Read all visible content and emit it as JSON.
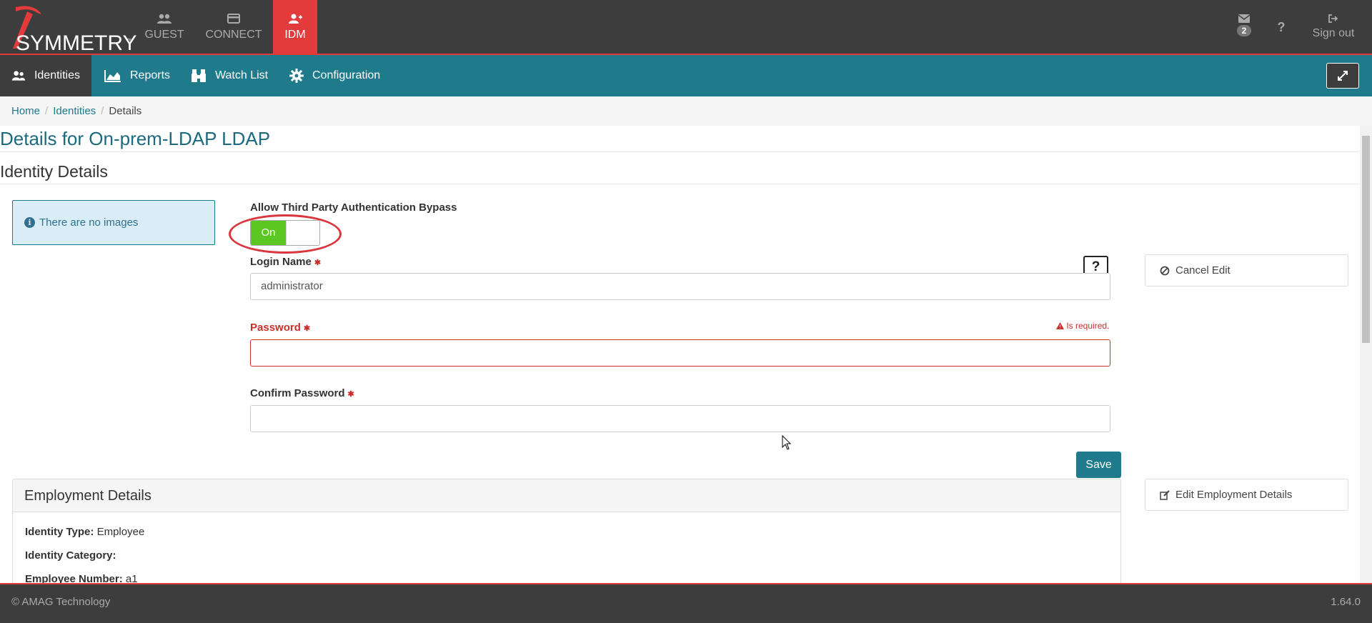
{
  "brand": {
    "name": "SYMMETRY",
    "tm": "™"
  },
  "topnav": [
    {
      "label": "GUEST",
      "icon": "users-icon"
    },
    {
      "label": "CONNECT",
      "icon": "card-icon"
    },
    {
      "label": "IDM",
      "icon": "add-user-icon",
      "active": true
    }
  ],
  "topright": {
    "mail_count": "2",
    "signout_label": "Sign out"
  },
  "subnav": {
    "identities": "Identities",
    "reports": "Reports",
    "watchlist": "Watch List",
    "configuration": "Configuration"
  },
  "breadcrumb": {
    "home": "Home",
    "identities": "Identities",
    "current": "Details"
  },
  "page": {
    "title": "Details for On-prem-LDAP LDAP",
    "section_title": "Identity Details",
    "no_images": "There are no images"
  },
  "form": {
    "bypass_label": "Allow Third Party Authentication Bypass",
    "bypass_state": "On",
    "login_label": "Login Name",
    "login_value": "administrator",
    "password_label": "Password",
    "password_error": "Is required.",
    "confirm_label": "Confirm Password",
    "help_label": "?",
    "save_label": "Save",
    "required_mark": "✱"
  },
  "actions": {
    "cancel_edit": "Cancel Edit",
    "edit_employment": "Edit Employment Details"
  },
  "employment": {
    "title": "Employment Details",
    "identity_type_label": "Identity Type:",
    "identity_type_value": "Employee",
    "identity_category_label": "Identity Category:",
    "identity_category_value": "",
    "employee_number_label": "Employee Number:",
    "employee_number_value": "a1"
  },
  "footer": {
    "copyright": "© AMAG Technology",
    "version": "1.64.0"
  },
  "colors": {
    "accent": "#1f7a8c",
    "brand_red": "#e33b3b",
    "toggle_on": "#5cc622",
    "error": "#c9302c"
  }
}
